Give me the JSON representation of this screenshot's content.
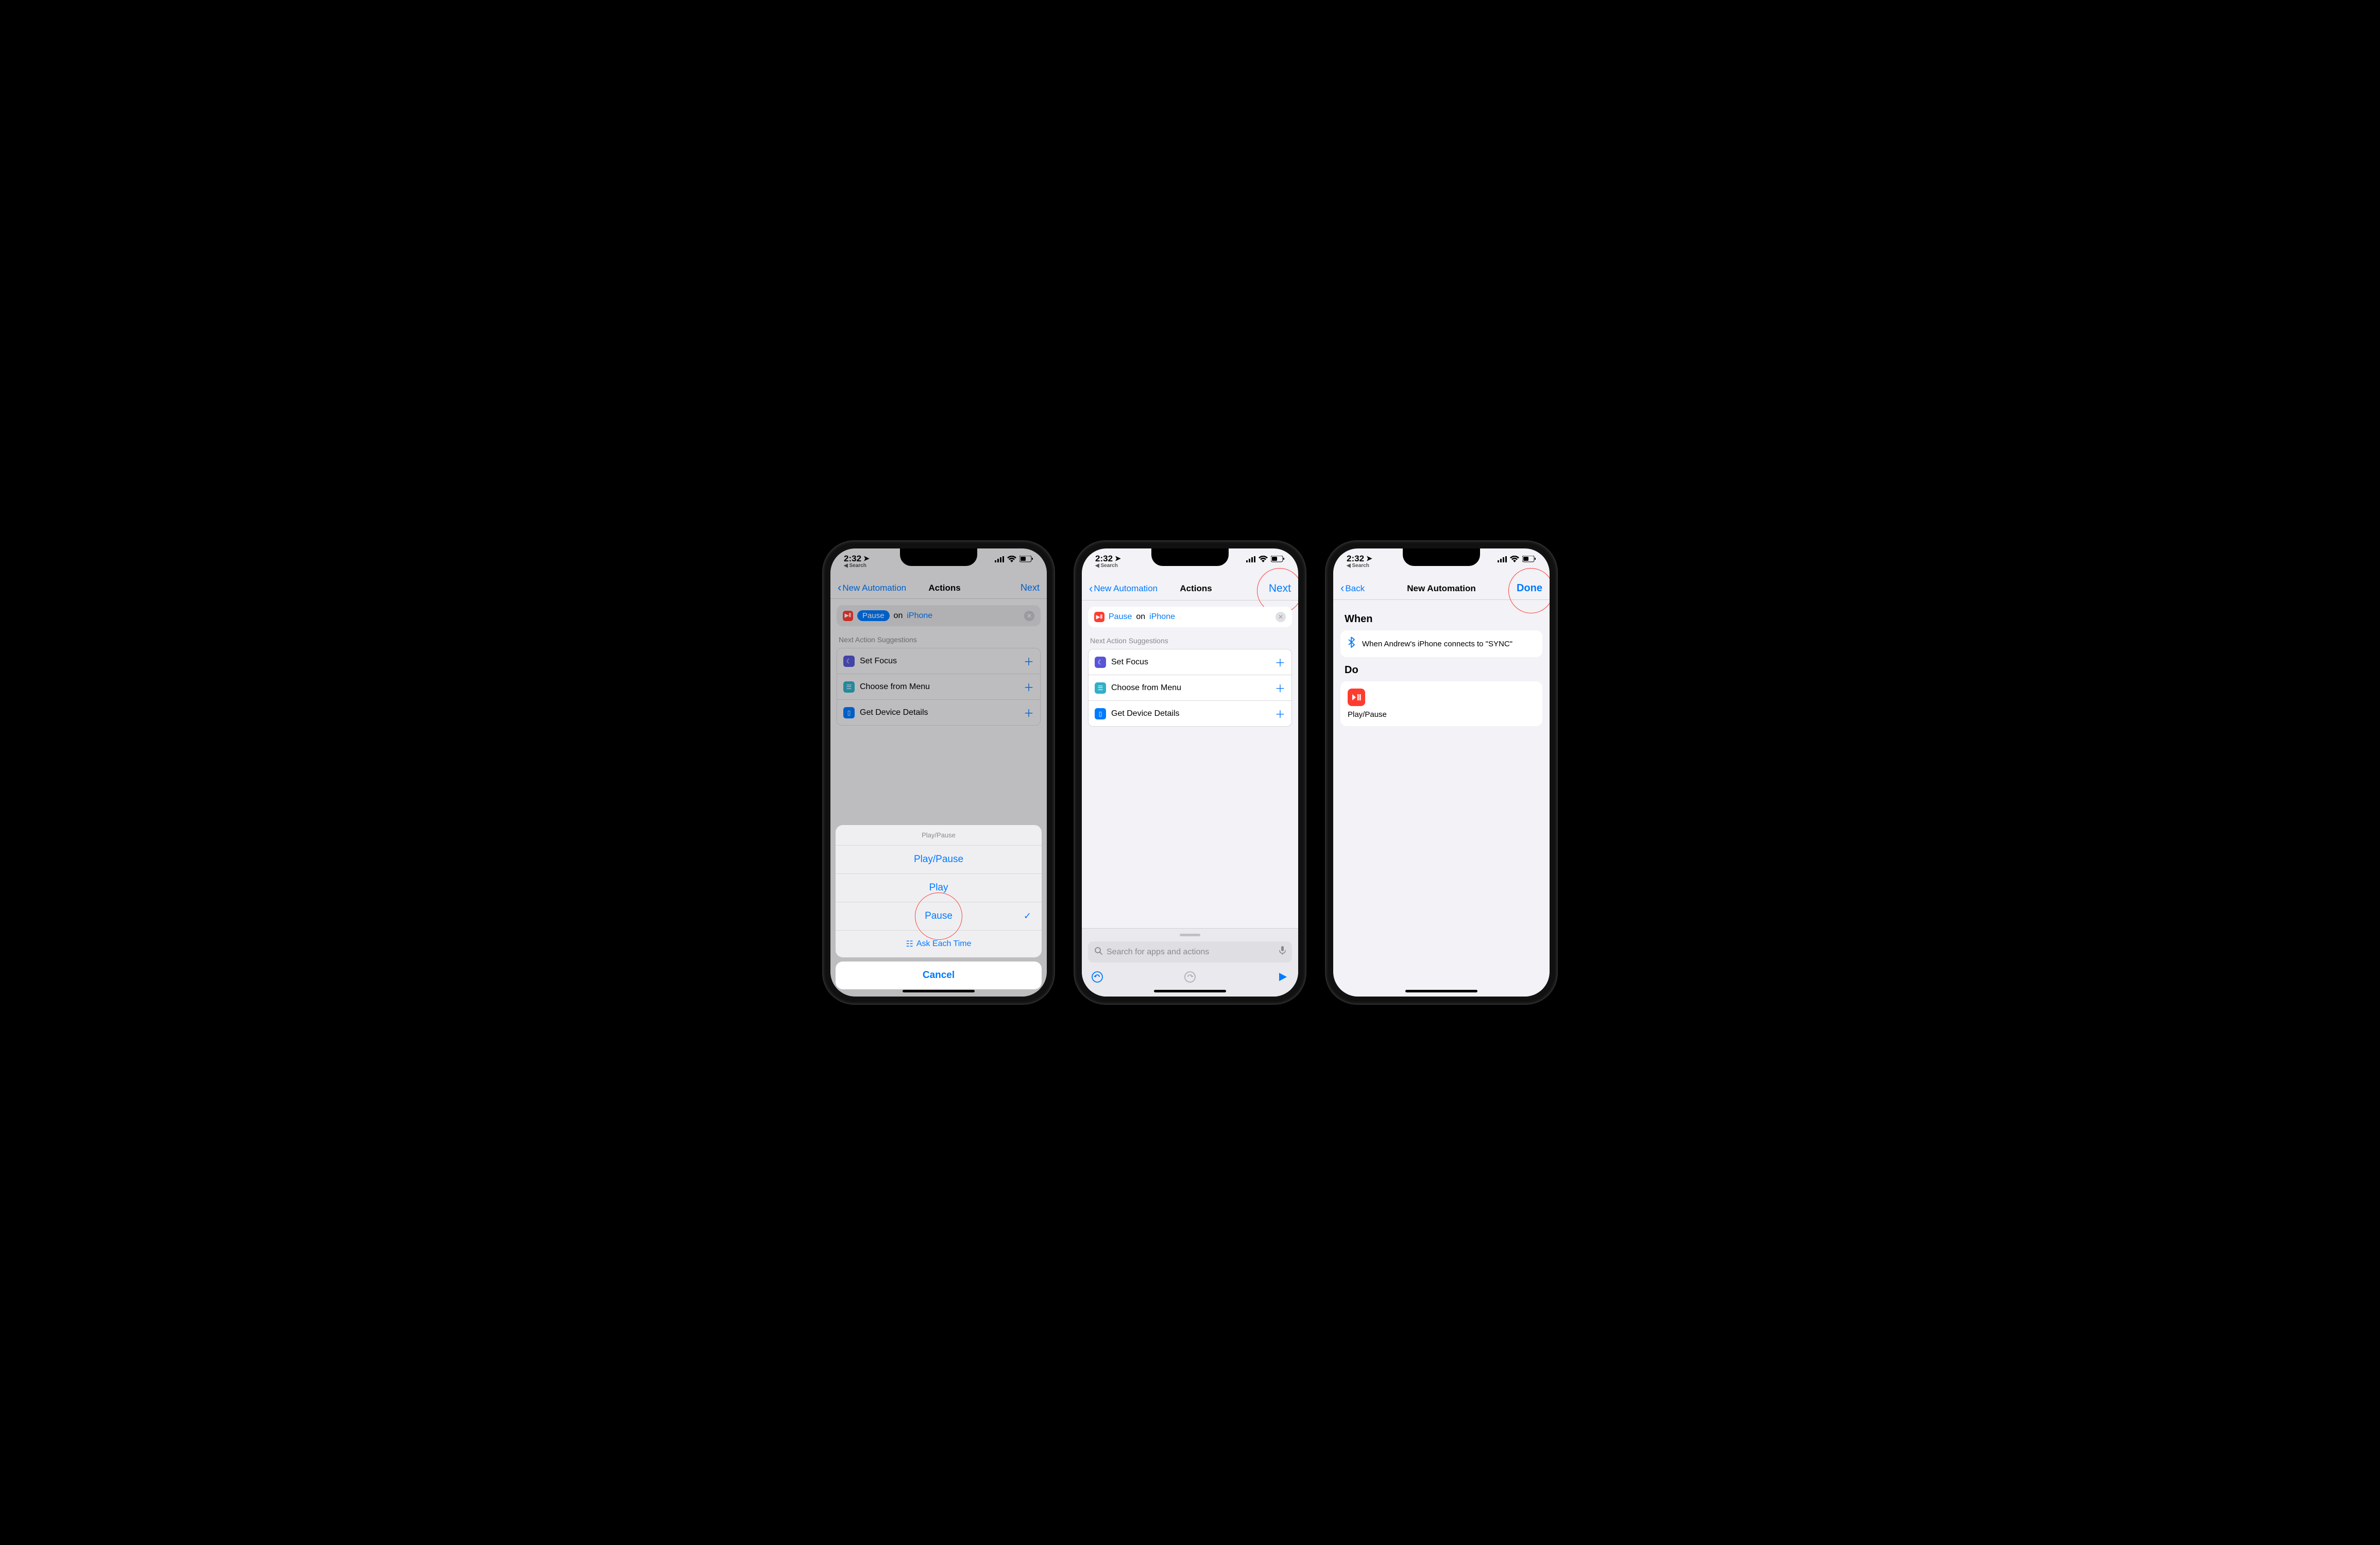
{
  "status": {
    "time": "2:32",
    "breadcrumb": "Search"
  },
  "screen1": {
    "nav_back": "New Automation",
    "nav_title": "Actions",
    "nav_next": "Next",
    "action_pill": "Pause",
    "action_on": "on",
    "action_device": "iPhone",
    "suggest_header": "Next Action Suggestions",
    "suggestions": [
      {
        "label": "Set Focus"
      },
      {
        "label": "Choose from Menu"
      },
      {
        "label": "Get Device Details"
      }
    ],
    "sheet_title": "Play/Pause",
    "sheet_options": [
      "Play/Pause",
      "Play",
      "Pause"
    ],
    "sheet_ask": "Ask Each Time",
    "cancel": "Cancel"
  },
  "screen2": {
    "nav_back": "New Automation",
    "nav_title": "Actions",
    "nav_next": "Next",
    "action_pill": "Pause",
    "action_on": "on",
    "action_device": "iPhone",
    "suggest_header": "Next Action Suggestions",
    "suggestions": [
      {
        "label": "Set Focus"
      },
      {
        "label": "Choose from Menu"
      },
      {
        "label": "Get Device Details"
      }
    ],
    "search_placeholder": "Search for apps and actions"
  },
  "screen3": {
    "nav_back": "Back",
    "nav_title": "New Automation",
    "nav_done": "Done",
    "when_title": "When",
    "when_text": "When Andrew's iPhone connects to \"SYNC\"",
    "do_title": "Do",
    "do_action": "Play/Pause"
  }
}
